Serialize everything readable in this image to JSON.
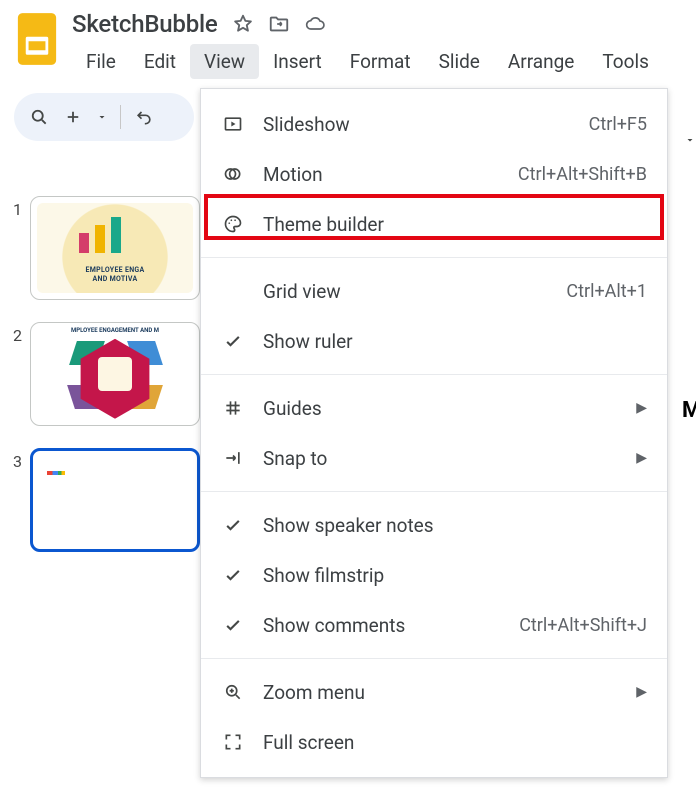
{
  "doc": {
    "title": "SketchBubble"
  },
  "menubar": {
    "items": [
      "File",
      "Edit",
      "View",
      "Insert",
      "Format",
      "Slide",
      "Arrange",
      "Tools"
    ],
    "active_index": 2
  },
  "filmstrip": {
    "slides": [
      {
        "number": "1",
        "selected": false,
        "caption_l1": "EMPLOYEE ENGA",
        "caption_l2": "AND MOTIVA"
      },
      {
        "number": "2",
        "selected": false,
        "caption": "MPLOYEE ENGAGEMENT AND M"
      },
      {
        "number": "3",
        "selected": true
      }
    ]
  },
  "view_menu": {
    "items": [
      {
        "icon": "slideshow-icon",
        "label": "Slideshow",
        "shortcut": "Ctrl+F5",
        "submenu": false
      },
      {
        "icon": "motion-icon",
        "label": "Motion",
        "shortcut": "Ctrl+Alt+Shift+B",
        "submenu": false
      },
      {
        "icon": "palette-icon",
        "label": "Theme builder",
        "shortcut": "",
        "submenu": false,
        "highlighted": true
      }
    ],
    "group2": [
      {
        "icon": "blank-icon",
        "label": "Grid view",
        "shortcut": "Ctrl+Alt+1",
        "submenu": false
      },
      {
        "icon": "check-icon",
        "label": "Show ruler",
        "shortcut": "",
        "submenu": false
      }
    ],
    "group3": [
      {
        "icon": "grid-icon",
        "label": "Guides",
        "shortcut": "",
        "submenu": true
      },
      {
        "icon": "snap-icon",
        "label": "Snap to",
        "shortcut": "",
        "submenu": true
      }
    ],
    "group4": [
      {
        "icon": "check-icon",
        "label": "Show speaker notes",
        "shortcut": "",
        "submenu": false
      },
      {
        "icon": "check-icon",
        "label": "Show filmstrip",
        "shortcut": "",
        "submenu": false
      },
      {
        "icon": "check-icon",
        "label": "Show comments",
        "shortcut": "Ctrl+Alt+Shift+J",
        "submenu": false
      }
    ],
    "group5": [
      {
        "icon": "zoom-icon",
        "label": "Zoom menu",
        "shortcut": "",
        "submenu": true
      },
      {
        "icon": "fullscreen-icon",
        "label": "Full screen",
        "shortcut": "",
        "submenu": false
      }
    ]
  }
}
